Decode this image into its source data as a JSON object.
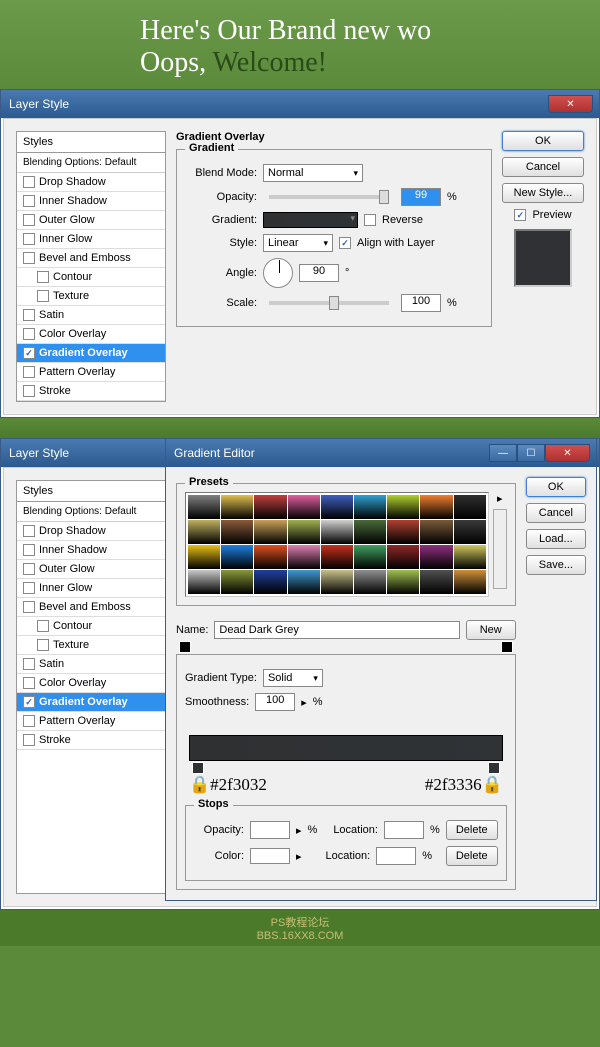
{
  "banner": {
    "line1": "Here's Our Brand new wo",
    "line2_a": "Oops, ",
    "line2_b": "Welcome!"
  },
  "dialog1": {
    "title": "Layer Style",
    "styles_header": "Styles",
    "blending_default": "Blending Options: Default",
    "items": [
      "Drop Shadow",
      "Inner Shadow",
      "Outer Glow",
      "Inner Glow",
      "Bevel and Emboss",
      "Contour",
      "Texture",
      "Satin",
      "Color Overlay",
      "Gradient Overlay",
      "Pattern Overlay",
      "Stroke"
    ],
    "section_title": "Gradient Overlay",
    "group_title": "Gradient",
    "blend_mode_label": "Blend Mode:",
    "blend_mode_value": "Normal",
    "opacity_label": "Opacity:",
    "opacity_value": "99",
    "opacity_pct": "%",
    "gradient_label": "Gradient:",
    "reverse_label": "Reverse",
    "style_label": "Style:",
    "style_value": "Linear",
    "align_label": "Align with Layer",
    "angle_label": "Angle:",
    "angle_value": "90",
    "angle_deg": "°",
    "scale_label": "Scale:",
    "scale_value": "100",
    "scale_pct": "%",
    "ok": "OK",
    "cancel": "Cancel",
    "new_style": "New Style...",
    "preview": "Preview"
  },
  "dialog2": {
    "title": "Gradient Editor",
    "presets_label": "Presets",
    "name_label": "Name:",
    "name_value": "Dead Dark Grey",
    "new_btn": "New",
    "type_label": "Gradient Type:",
    "type_value": "Solid",
    "smooth_label": "Smoothness:",
    "smooth_value": "100",
    "pct": "%",
    "stop_left": "#2f3032",
    "stop_right": "#2f3336",
    "stops_label": "Stops",
    "opacity_label": "Opacity:",
    "location_label": "Location:",
    "color_label": "Color:",
    "delete": "Delete",
    "ok": "OK",
    "cancel": "Cancel",
    "load": "Load...",
    "save": "Save..."
  },
  "footer": {
    "l1": "PS教程论坛",
    "l2": "BBS.16XX8.COM"
  },
  "preset_colors": [
    "#808080",
    "#e0c050",
    "#c04040",
    "#e060a0",
    "#4060c0",
    "#30a0d0",
    "#b0d030",
    "#f08030",
    "#303030",
    "#c0b060",
    "#8a5a3a",
    "#c8a058",
    "#a0b050",
    "#d0d0d0",
    "#4a6a3a",
    "#b04030",
    "#7a5a3a",
    "#3a3a3a",
    "#e8c018",
    "#2080e0",
    "#e05020",
    "#e080b0",
    "#c83020",
    "#40a060",
    "#902828",
    "#903080",
    "#d0c860",
    "#c8c8c8",
    "#889838",
    "#2040a0",
    "#4098d0",
    "#c8c08a",
    "#909090",
    "#a0c050",
    "#505050",
    "#d09038"
  ]
}
